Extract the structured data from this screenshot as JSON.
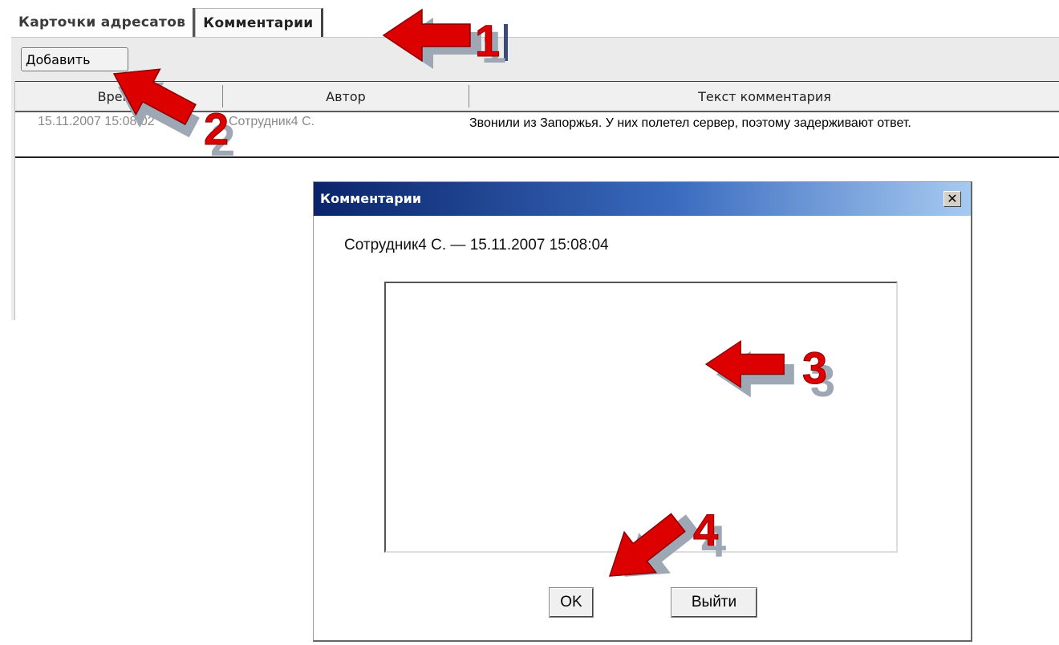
{
  "tabs": [
    {
      "label": "Карточки адресатов",
      "active": false
    },
    {
      "label": "Комментарии",
      "active": true
    }
  ],
  "toolbar": {
    "add_label": "Добавить"
  },
  "grid": {
    "columns": [
      "Время",
      "Автор",
      "Текст комментария"
    ],
    "rows": [
      {
        "time": "15.11.2007 15:08:02",
        "author": "Сотрудник4 С.",
        "text": "Звонили из Запоржья. У них полетел сервер, поэтому задерживают ответ."
      }
    ]
  },
  "dialog": {
    "title": "Комментарии",
    "meta": "Сотрудник4 С. — 15.11.2007 15:08:04",
    "comment_value": "",
    "ok_label": "OK",
    "exit_label": "Выйти",
    "close_glyph": "✕"
  },
  "annotations": [
    "1",
    "2",
    "3",
    "4"
  ],
  "colors": {
    "arrow": "#dd0000",
    "arrow_shadow": "#9ea7b4",
    "title_start": "#0a246a",
    "title_end": "#a6caf0"
  },
  "icons": [
    "arrow-icon",
    "close-icon"
  ]
}
